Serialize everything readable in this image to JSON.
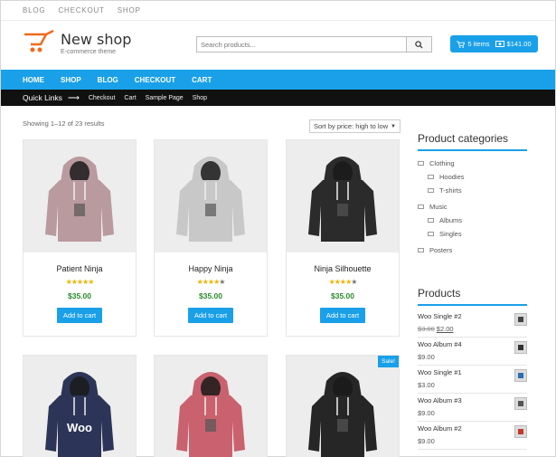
{
  "topbar": {
    "links": [
      "BLOG",
      "CHECKOUT",
      "SHOP"
    ]
  },
  "header": {
    "logo_name": "New shop",
    "logo_tagline": "E-commerce theme",
    "search_placeholder": "Search products...",
    "cart_label": "5 items",
    "cart_total": "$141.00"
  },
  "nav": {
    "items": [
      "HOME",
      "SHOP",
      "BLOG",
      "CHECKOUT",
      "CART"
    ]
  },
  "quick_links": {
    "label": "Quick Links",
    "items": [
      "Checkout",
      "Cart",
      "Sample Page",
      "Shop"
    ]
  },
  "shop": {
    "result_count": "Showing 1–12 of 23 results",
    "sort_selected": "Sort by price: high to low",
    "add_to_cart_label": "Add to cart",
    "products": [
      {
        "name": "Patient Ninja",
        "price": "$35.00",
        "rating": 5,
        "color": "#b99a9f"
      },
      {
        "name": "Happy Ninja",
        "price": "$35.00",
        "rating": 4,
        "color": "#c8c8c8"
      },
      {
        "name": "Ninja Silhouette",
        "price": "$35.00",
        "rating": 4,
        "color": "#2b2b2b"
      },
      {
        "name": "",
        "price": "",
        "rating": 0,
        "color": "#2c3557",
        "print": "Woo"
      },
      {
        "name": "",
        "price": "",
        "rating": 0,
        "color": "#c9626e"
      },
      {
        "name": "",
        "price": "",
        "rating": 0,
        "color": "#262626",
        "sale": "Sale!"
      }
    ]
  },
  "sidebar": {
    "categories_title": "Product categories",
    "categories": [
      {
        "label": "Clothing",
        "level": 0
      },
      {
        "label": "Hoodies",
        "level": 1
      },
      {
        "label": "T-shirts",
        "level": 1
      },
      {
        "label": "Music",
        "level": 0
      },
      {
        "label": "Albums",
        "level": 1
      },
      {
        "label": "Singles",
        "level": 1
      },
      {
        "label": "Posters",
        "level": 0
      }
    ],
    "products_title": "Products",
    "products": [
      {
        "name": "Woo Single #2",
        "old_price": "$3.00",
        "price": "$2.00"
      },
      {
        "name": "Woo Album #4",
        "old_price": "",
        "price": "$9.00"
      },
      {
        "name": "Woo Single #1",
        "old_price": "",
        "price": "$3.00"
      },
      {
        "name": "Woo Album #3",
        "old_price": "",
        "price": "$9.00"
      },
      {
        "name": "Woo Album #2",
        "old_price": "",
        "price": "$9.00"
      }
    ]
  },
  "colors": {
    "accent": "#1aa0e8",
    "logo_orange": "#f06a1d",
    "price_green": "#2a8a2a",
    "quick_bar": "#111111"
  }
}
